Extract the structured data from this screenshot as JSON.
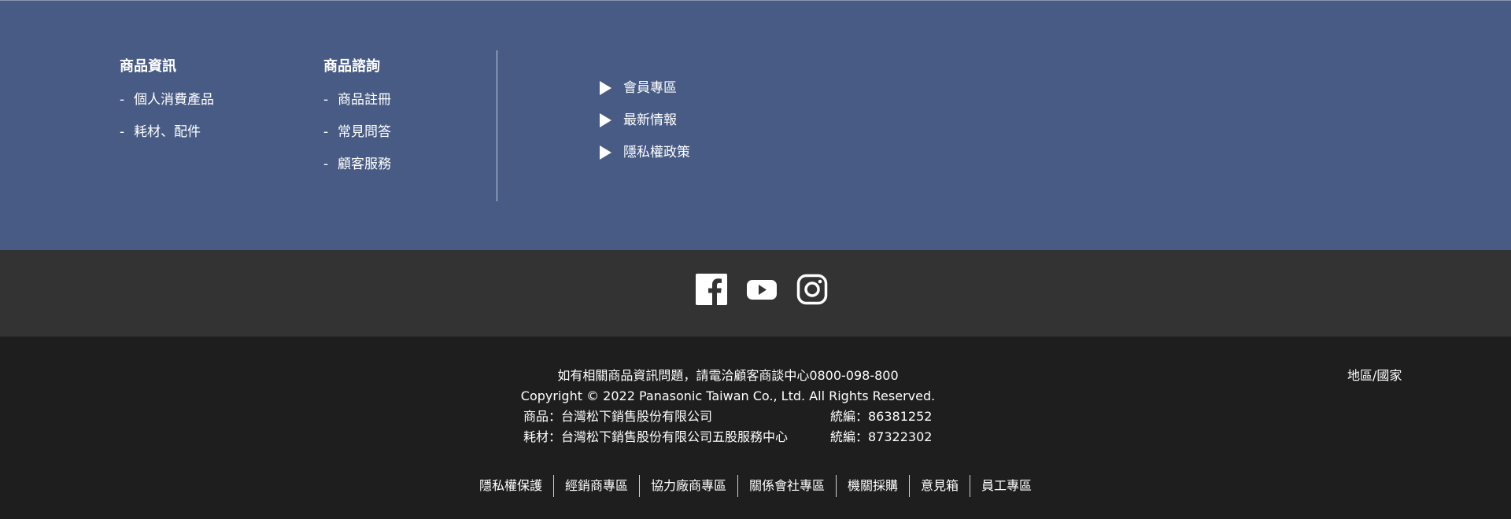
{
  "top": {
    "product_info": {
      "heading": "商品資訊",
      "items": [
        "個人消費產品",
        "耗材、配件"
      ]
    },
    "product_inquiry": {
      "heading": "商品諮詢",
      "items": [
        "商品註冊",
        "常見問答",
        "顧客服務"
      ]
    },
    "quick_links": [
      "會員專區",
      "最新情報",
      "隱私權政策"
    ],
    "dash": "-"
  },
  "social": {
    "icons": [
      "facebook-icon",
      "youtube-icon",
      "instagram-icon"
    ]
  },
  "bottom": {
    "hotline": "如有相關商品資訊問題，請電洽顧客商談中心0800-098-800",
    "copyright": "Copyright © 2022 Panasonic Taiwan Co., Ltd. All Rights Reserved.",
    "company1": "商品：台灣松下銷售股份有限公司",
    "company1_id": "統編：86381252",
    "company2": "耗材：台灣松下銷售股份有限公司五股服務中心",
    "company2_id": "統編：87322302",
    "region": "地區/國家",
    "links": [
      "隱私權保護",
      "經銷商專區",
      "協力廠商專區",
      "關係會社專區",
      "機關採購",
      "意見箱",
      "員工專區"
    ]
  },
  "colors": {
    "top_bg": "#475b85",
    "social_bg": "#333333",
    "bottom_bg": "#1e1e1e"
  }
}
